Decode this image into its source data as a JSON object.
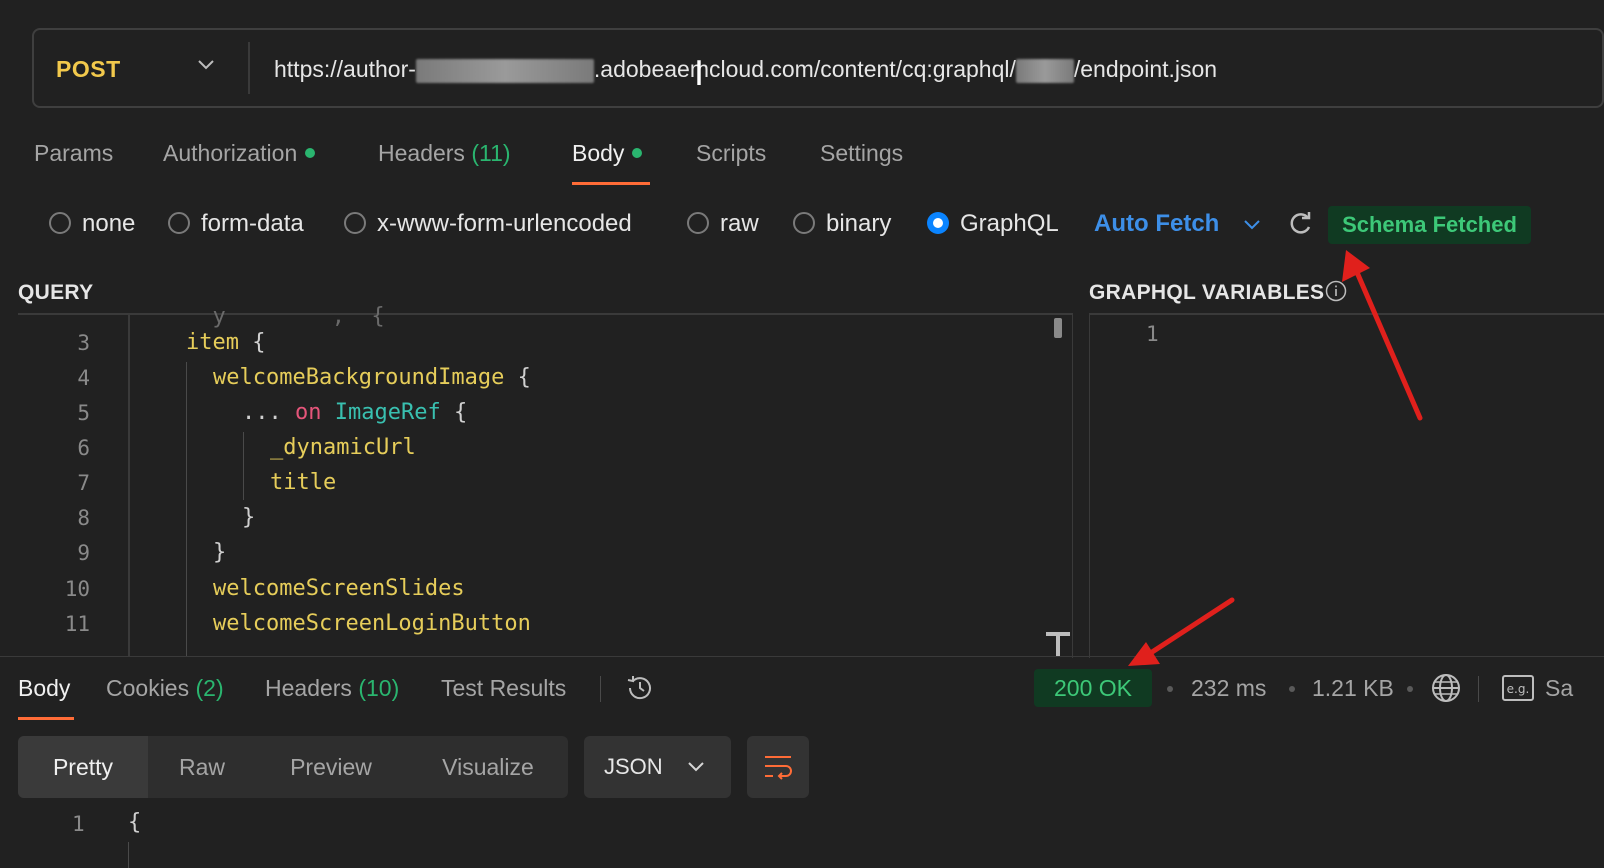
{
  "request": {
    "method": "POST",
    "url_prefix": "https://author-",
    "url_middle": ".adobeaemcloud.com/content/cq:graphql/",
    "url_suffix": "/endpoint.json"
  },
  "request_tabs": {
    "params": "Params",
    "authorization": "Authorization",
    "headers": "Headers",
    "headers_count": "(11)",
    "body": "Body",
    "scripts": "Scripts",
    "settings": "Settings"
  },
  "body_types": {
    "none": "none",
    "form_data": "form-data",
    "urlencoded": "x-www-form-urlencoded",
    "raw": "raw",
    "binary": "binary",
    "graphql": "GraphQL",
    "selected": "GraphQL"
  },
  "graphql": {
    "auto_fetch": "Auto Fetch",
    "schema_status": "Schema Fetched",
    "query_heading": "QUERY",
    "variables_heading": "GRAPHQL VARIABLES",
    "query_lines": {
      "l3": {
        "n": "3",
        "field": "item"
      },
      "l4": {
        "n": "4",
        "field": "welcomeBackgroundImage"
      },
      "l5": {
        "n": "5",
        "dots": "...",
        "kw": "on",
        "type": "ImageRef"
      },
      "l6": {
        "n": "6",
        "field": "_dynamicUrl"
      },
      "l7": {
        "n": "7",
        "field": "title"
      },
      "l8": {
        "n": "8"
      },
      "l9": {
        "n": "9"
      },
      "l10": {
        "n": "10",
        "field": "welcomeScreenSlides"
      },
      "l11": {
        "n": "11",
        "field": "welcomeScreenLoginButton"
      }
    },
    "variables_line": "1"
  },
  "response": {
    "tabs": {
      "body": "Body",
      "cookies": "Cookies",
      "cookies_count": "(2)",
      "headers": "Headers",
      "headers_count": "(10)",
      "test_results": "Test Results"
    },
    "status": "200 OK",
    "time": "232 ms",
    "size": "1.21 KB",
    "save_partial": "Sa",
    "views": {
      "pretty": "Pretty",
      "raw": "Raw",
      "preview": "Preview",
      "visualize": "Visualize"
    },
    "format": "JSON",
    "line1": "1",
    "brace": "{"
  },
  "colors": {
    "accent": "#ff6c37",
    "success": "#3dc878",
    "method": "#f2c94c",
    "link": "#3d8fe8",
    "annotation_arrow": "#e0201c"
  }
}
